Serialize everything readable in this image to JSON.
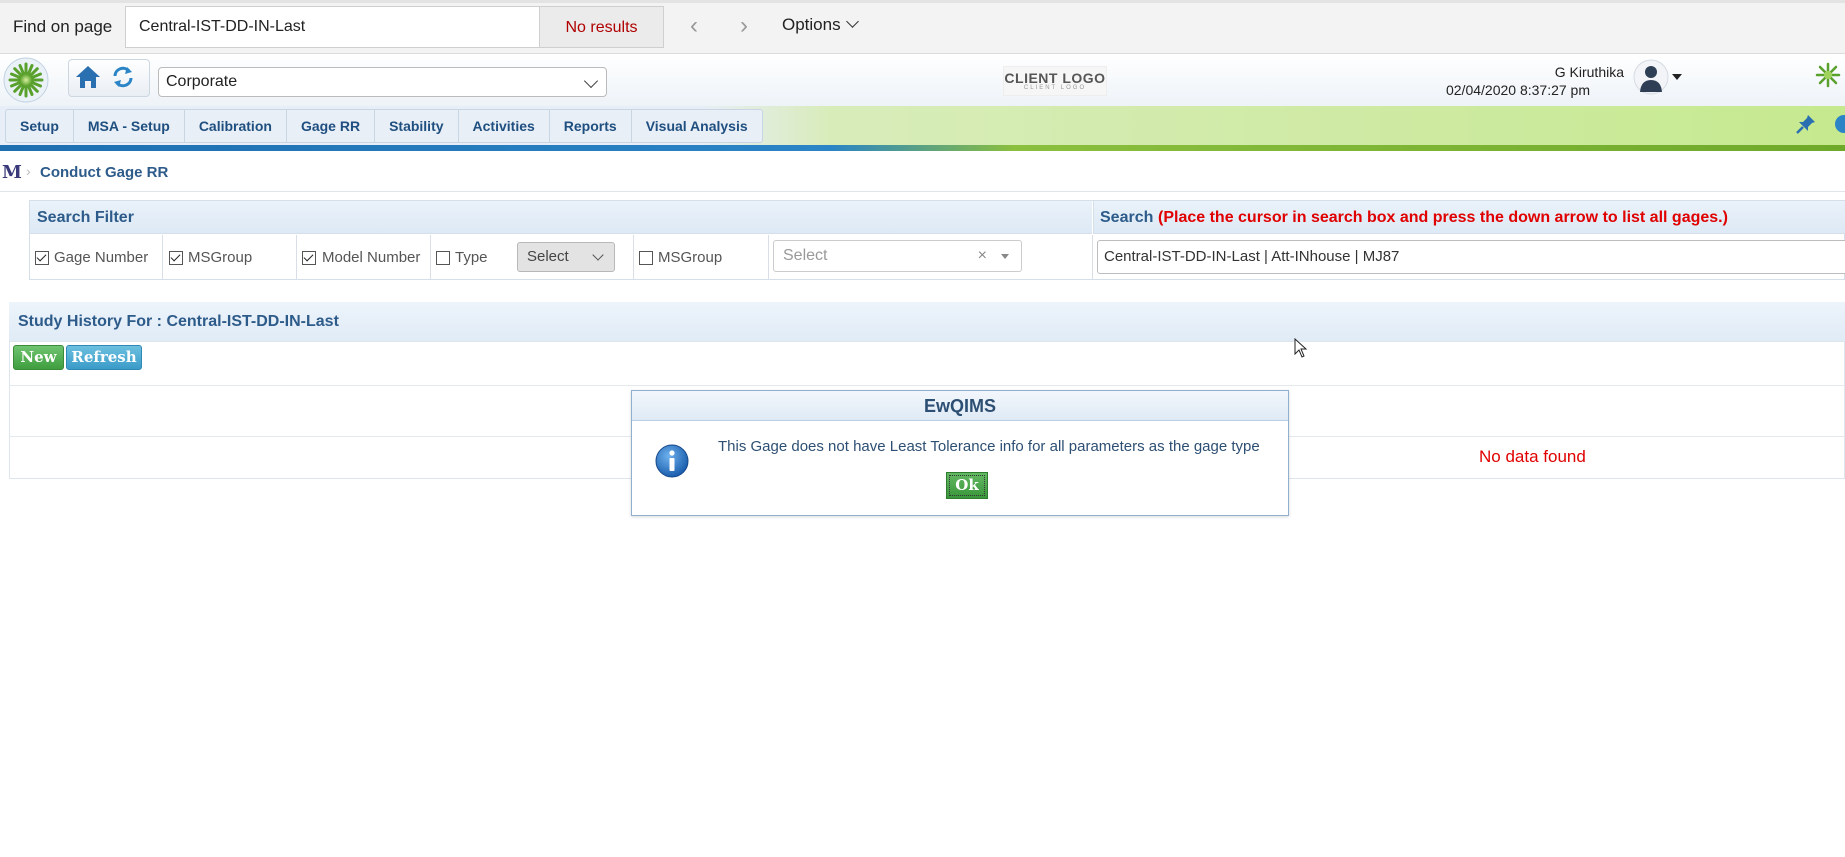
{
  "find_bar": {
    "label": "Find on page",
    "query": "Central-IST-DD-IN-Last",
    "results": "No results",
    "prev_glyph": "‹",
    "next_glyph": "›",
    "options_label": "Options"
  },
  "header": {
    "org_select_value": "Corporate",
    "client_logo_main": "CLIENT LOGO",
    "client_logo_sub": "CLIENT LOGO",
    "user_name": "G Kiruthika",
    "user_datetime": "02/04/2020 8:37:27 pm"
  },
  "menu": {
    "items": [
      "Setup",
      "MSA - Setup",
      "Calibration",
      "Gage RR",
      "Stability",
      "Activities",
      "Reports",
      "Visual Analysis"
    ]
  },
  "breadcrumb": {
    "root_glyph": "M",
    "separator": "›",
    "title": "Conduct Gage RR"
  },
  "filter": {
    "title": "Search Filter",
    "checkboxes": [
      {
        "label": "Gage Number",
        "checked": true
      },
      {
        "label": "MSGroup",
        "checked": true
      },
      {
        "label": "Model Number",
        "checked": true
      },
      {
        "label": "Type",
        "checked": false
      },
      {
        "label": "MSGroup",
        "checked": false
      }
    ],
    "type_select_value": "Select",
    "msgroup_select_placeholder": "Select",
    "msgroup_clear": "×"
  },
  "search": {
    "title": "Search",
    "hint": "(Place the cursor in search box and press the down arrow to list all gages.)",
    "value": "Central-IST-DD-IN-Last | Att-INhouse | MJ87"
  },
  "history": {
    "title": "Study History For : Central-IST-DD-IN-Last",
    "new_label": "New",
    "refresh_label": "Refresh",
    "no_data": "No data found"
  },
  "dialog": {
    "title": "EwQIMS",
    "message": "This Gage does not have Least Tolerance info for all parameters as the gage type",
    "ok_label": "Ok"
  },
  "colors": {
    "accent_blue": "#2d5b8a",
    "error_red": "#e00000",
    "ok_green": "#3a963a"
  }
}
